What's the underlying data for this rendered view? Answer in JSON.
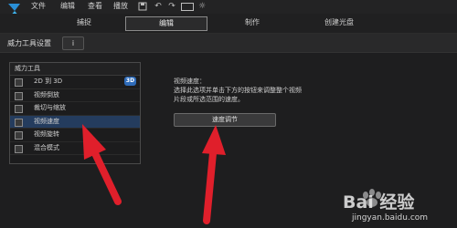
{
  "menubar": {
    "items": [
      "文件",
      "编辑",
      "查看",
      "播放"
    ]
  },
  "tabs": [
    {
      "label": "捕捉",
      "active": false
    },
    {
      "label": "编辑",
      "active": true
    },
    {
      "label": "制作",
      "active": false
    },
    {
      "label": "创建光盘",
      "active": false
    }
  ],
  "room": {
    "title": "威力工具设置",
    "info_label": "i"
  },
  "tools": {
    "header": "威力工具",
    "items": [
      {
        "label": "2D 到 3D",
        "badge": "3D",
        "selected": false
      },
      {
        "label": "视频倒放",
        "selected": false
      },
      {
        "label": "裁切与缩放",
        "selected": false
      },
      {
        "label": "视频速度",
        "selected": true
      },
      {
        "label": "视频旋转",
        "selected": false
      },
      {
        "label": "混合模式",
        "selected": false
      }
    ]
  },
  "details": {
    "line1": "视频速度：",
    "line2": "选择此选项并单击下方的按钮来调整整个视频",
    "line3": "片段或所选范围的速度。",
    "button_label": "速度调节"
  },
  "watermark": {
    "brand": "Bai 经验",
    "url": "jingyan.baidu.com"
  },
  "colors": {
    "accent": "#2e6bb8",
    "selected_row": "#243c5e",
    "arrow": "#e01f2b"
  }
}
